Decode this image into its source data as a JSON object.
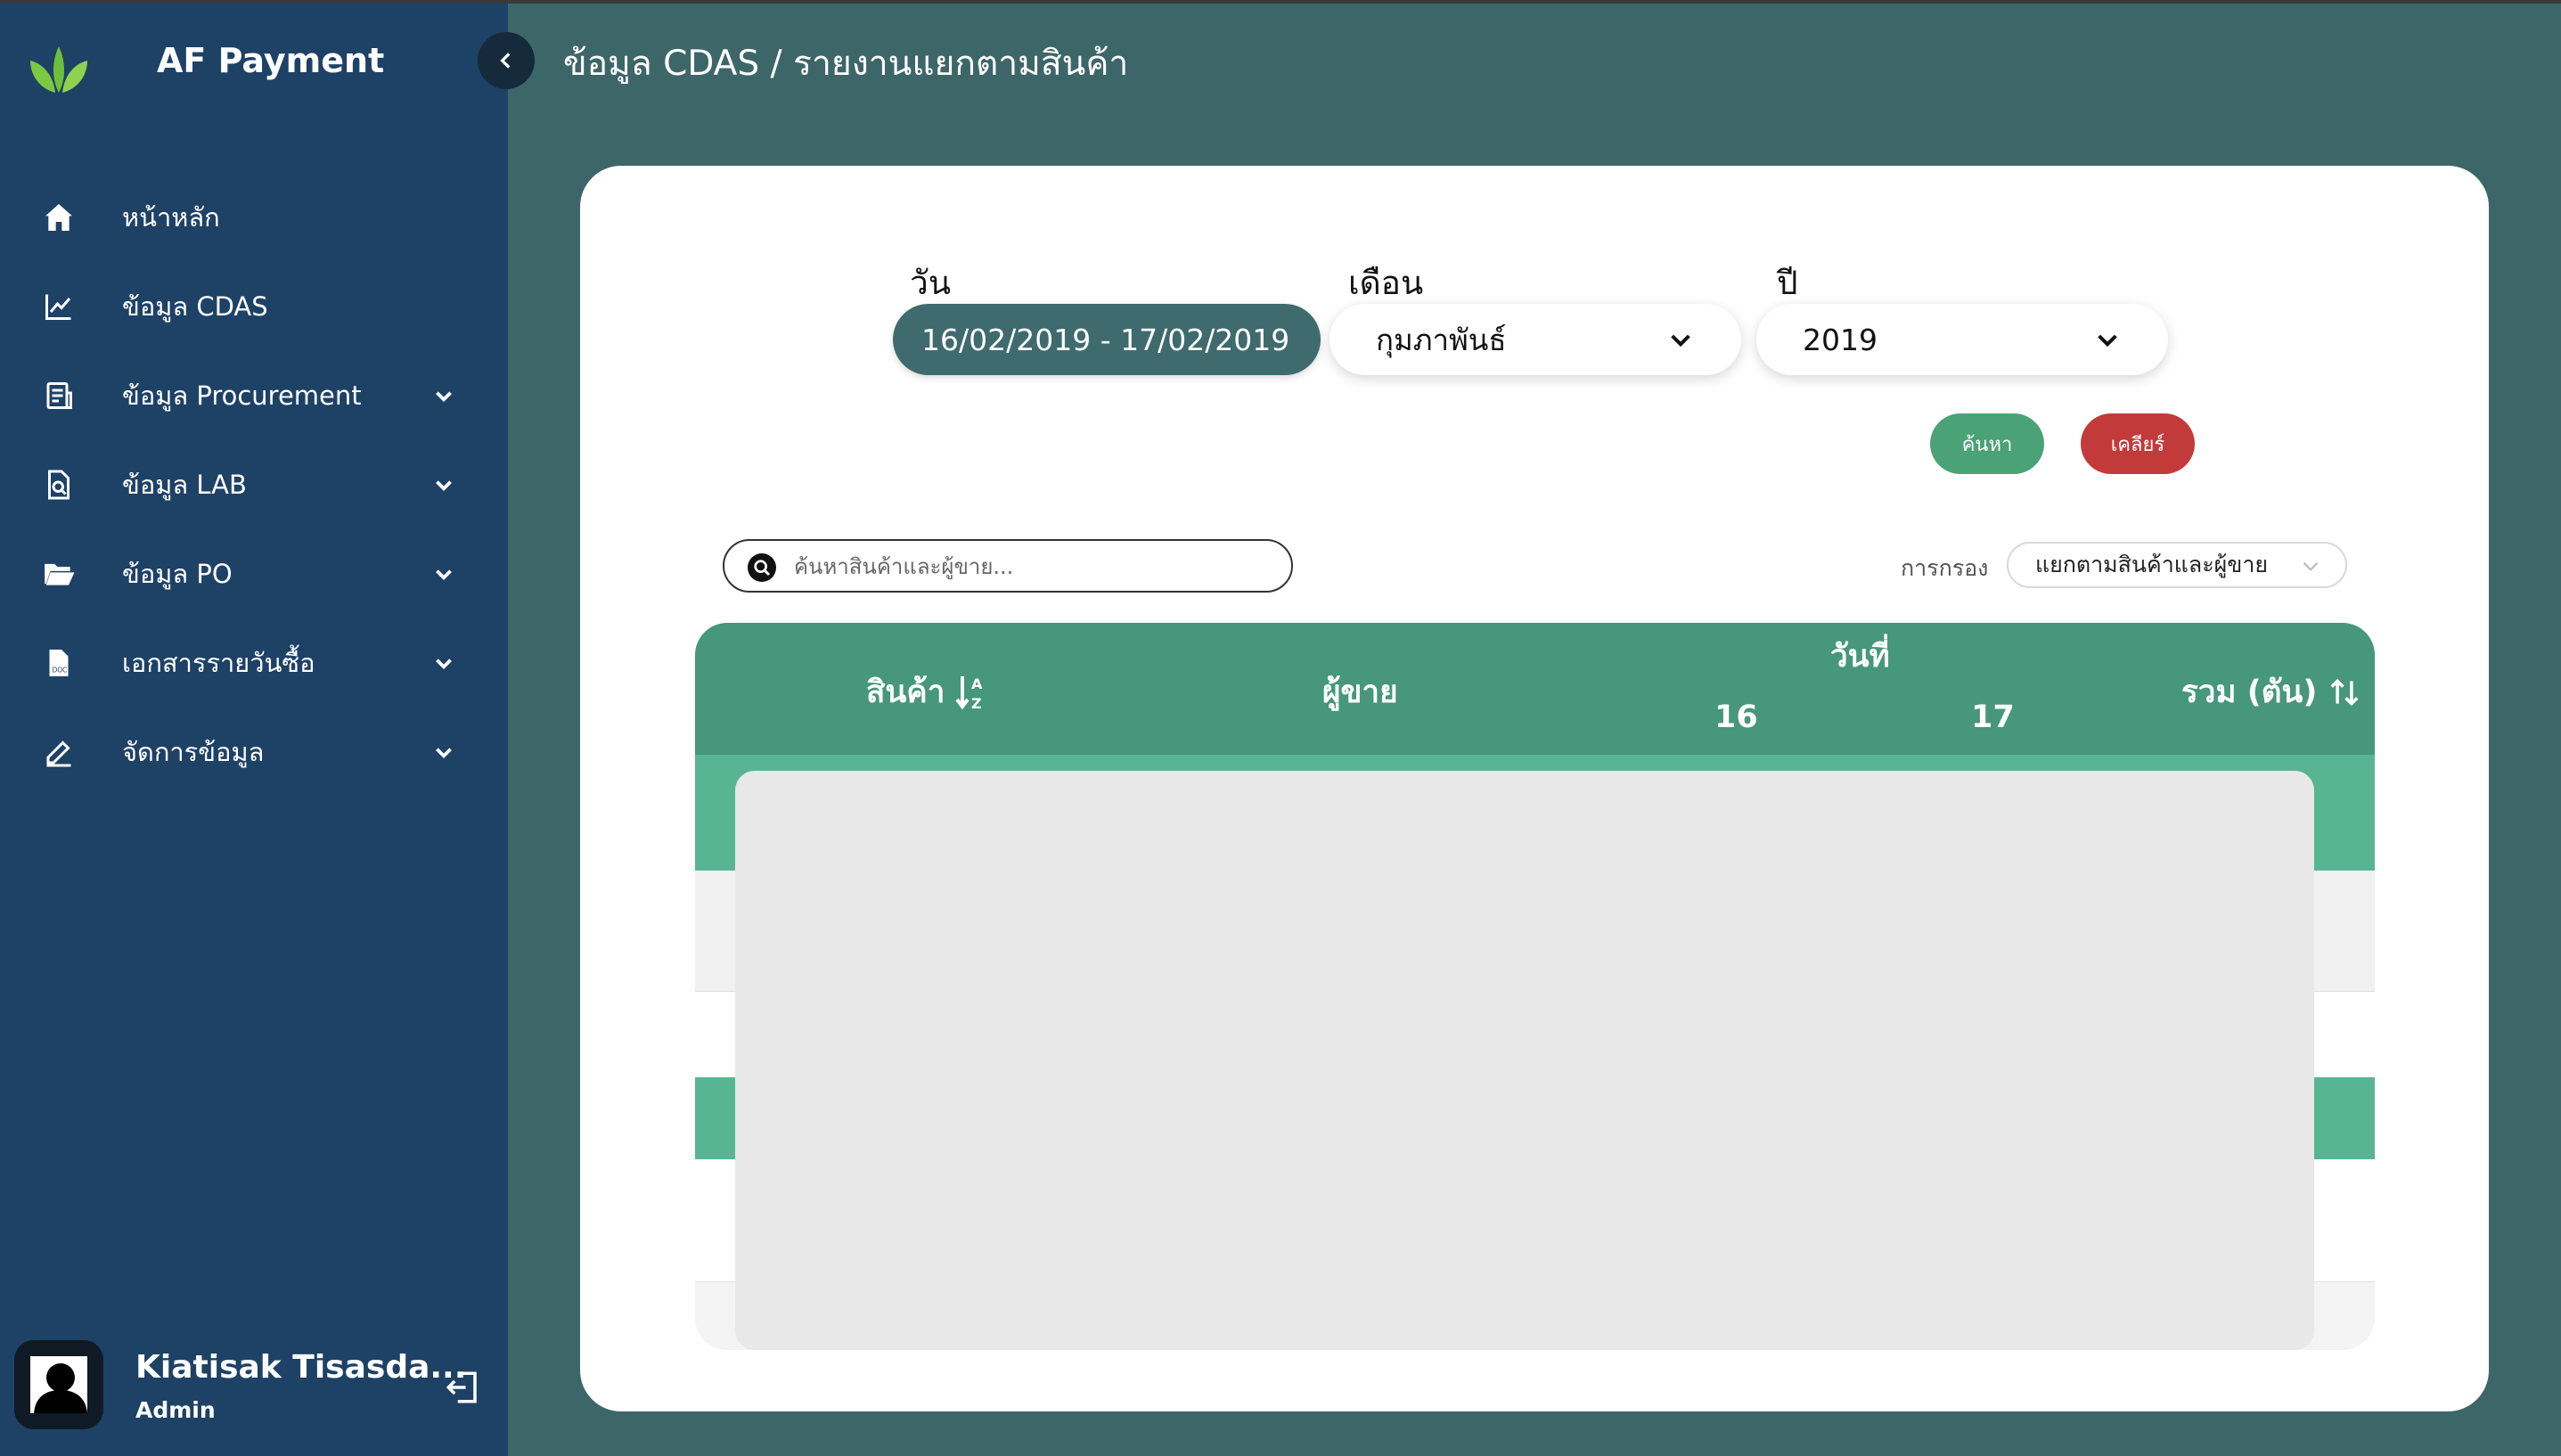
{
  "app": {
    "name": "AF Payment"
  },
  "colors": {
    "sidebar": "#1e4166",
    "background": "#3d6669",
    "accent_green": "#46977b",
    "button_green": "#4aa276",
    "button_red": "#c23a3a",
    "date_pill": "#3f6b6e"
  },
  "nav": [
    {
      "label": "หน้าหลัก",
      "icon": "home-icon",
      "expandable": false
    },
    {
      "label": "ข้อมูล CDAS",
      "icon": "line-chart-icon",
      "expandable": false
    },
    {
      "label": "ข้อมูล Procurement",
      "icon": "document-list-icon",
      "expandable": true
    },
    {
      "label": "ข้อมูล LAB",
      "icon": "document-search-icon",
      "expandable": true
    },
    {
      "label": "ข้อมูล PO",
      "icon": "folder-open-icon",
      "expandable": true
    },
    {
      "label": "เอกสารรายวันซื้อ",
      "icon": "doc-file-icon",
      "expandable": true
    },
    {
      "label": "จัดการข้อมูล",
      "icon": "edit-icon",
      "expandable": true
    }
  ],
  "user": {
    "name": "Kiatisak Tisasda...",
    "role": "Admin"
  },
  "breadcrumb": "ข้อมูล CDAS / รายงานแยกตามสินค้า",
  "filters": {
    "day_label": "วัน",
    "day_value": "16/02/2019 - 17/02/2019",
    "month_label": "เดือน",
    "month_value": "กุมภาพันธ์",
    "year_label": "ปี",
    "year_value": "2019",
    "search_button": "ค้นหา",
    "clear_button": "เคลียร์"
  },
  "table_tools": {
    "search_placeholder": "ค้นหาสินค้าและผู้ขาย...",
    "filter_label": "การกรอง",
    "filter_value": "แยกตามสินค้าและผู้ขาย"
  },
  "table": {
    "columns": {
      "product": "สินค้า",
      "seller": "ผู้ขาย",
      "date_group": "วันที่",
      "day_1": "16",
      "day_2": "17",
      "total": "รวม (ตัน)"
    }
  }
}
